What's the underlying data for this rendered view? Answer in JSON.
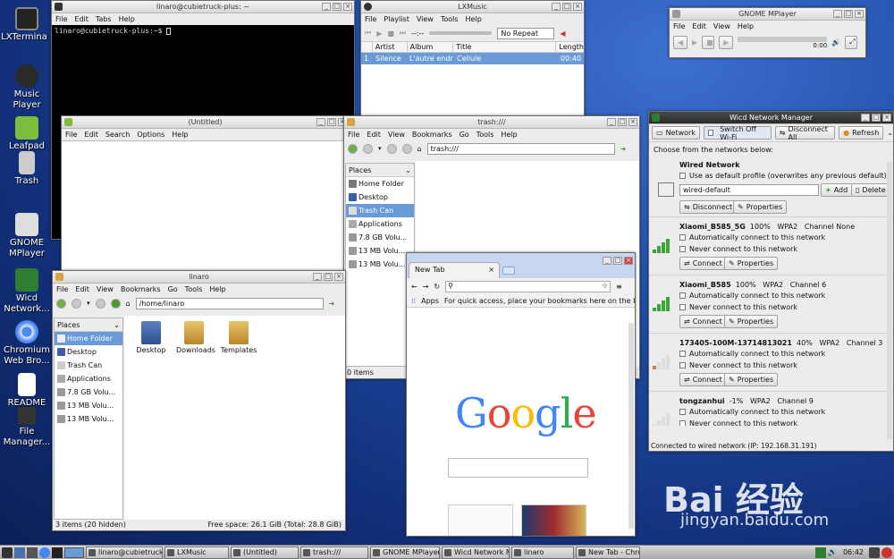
{
  "desktop": {
    "icons": [
      "LXTermina l",
      "Music Player",
      "Leafpad",
      "Trash",
      "GNOME MPlayer",
      "Wicd Network...",
      "Chromium Web Bro...",
      "README",
      "File Manager..."
    ]
  },
  "terminal": {
    "title": "linaro@cubietruck-plus: ~",
    "menu": [
      "File",
      "Edit",
      "Tabs",
      "Help"
    ],
    "prompt": "linaro@cubietruck-plus:~$ "
  },
  "lxmusic": {
    "title": "LXMusic",
    "menu": [
      "File",
      "Playlist",
      "View",
      "Tools",
      "Help"
    ],
    "time": "--:--",
    "repeat": "No Repeat",
    "columns": [
      "Artist",
      "Album",
      "Title",
      "Length"
    ],
    "row": {
      "num": "1",
      "artist": "Silence",
      "album": "L'autre endr...",
      "title": "Cellule",
      "length": "00:40"
    }
  },
  "mplayer": {
    "title": "GNOME MPlayer",
    "menu": [
      "File",
      "Edit",
      "View",
      "Help"
    ],
    "time": "0:00"
  },
  "leafpad": {
    "title": "(Untitled)",
    "menu": [
      "File",
      "Edit",
      "Search",
      "Options",
      "Help"
    ]
  },
  "trash": {
    "title": "trash:///",
    "menu": [
      "File",
      "Edit",
      "View",
      "Bookmarks",
      "Go",
      "Tools",
      "Help"
    ],
    "address": "trash:///",
    "places_header": "Places",
    "places": [
      "Home Folder",
      "Desktop",
      "Trash Can",
      "Applications",
      "7.8 GB Volu...",
      "13 MB Volu...",
      "13 MB Volu..."
    ],
    "status": "0 items"
  },
  "linaro": {
    "title": "linaro",
    "menu": [
      "File",
      "Edit",
      "View",
      "Bookmarks",
      "Go",
      "Tools",
      "Help"
    ],
    "address": "/home/linaro",
    "places_header": "Places",
    "places": [
      "Home Folder",
      "Desktop",
      "Trash Can",
      "Applications",
      "7.8 GB Volu...",
      "13 MB Volu...",
      "13 MB Volu..."
    ],
    "files": [
      "Desktop",
      "Downloads",
      "Templates"
    ],
    "status_left": "3 items (20 hidden)",
    "status_right": "Free space: 26.1 GiB (Total: 28.8 GiB)"
  },
  "chrome": {
    "tab": "New Tab",
    "apps": "Apps",
    "bookmarks_hint": "For quick access, place your bookmarks here on the book...",
    "logo": [
      "G",
      "o",
      "o",
      "g",
      "l",
      "e"
    ]
  },
  "wicd": {
    "title": "Wicd Network Manager",
    "toolbar": [
      "Network",
      "Switch Off Wi-Fi",
      "Disconnect All",
      "Refresh"
    ],
    "choose": "Choose from the networks below:",
    "wired": {
      "title": "Wired Network",
      "default_label": "Use as default profile (overwrites any previous default)",
      "profile": "wired-default",
      "add": "Add",
      "delete": "Delete",
      "disconnect": "Disconnect",
      "properties": "Properties"
    },
    "networks": [
      {
        "name": "Xiaomi_B585_5G",
        "strength": "100%",
        "security": "WPA2",
        "channel": "Channel None",
        "auto": "Automatically connect to this network",
        "never": "Never connect to this network",
        "connect": "Connect",
        "properties": "Properties",
        "level": 1.0
      },
      {
        "name": "Xiaomi_B585",
        "strength": "100%",
        "security": "WPA2",
        "channel": "Channel 6",
        "auto": "Automatically connect to this network",
        "never": "Never connect to this network",
        "connect": "Connect",
        "properties": "Properties",
        "level": 1.0
      },
      {
        "name": "173405-100M-13714813021",
        "strength": "40%",
        "security": "WPA2",
        "channel": "Channel 3",
        "auto": "Automatically connect to this network",
        "never": "Never connect to this network",
        "connect": "Connect",
        "properties": "Properties",
        "level": 0.4
      },
      {
        "name": "tongzanhui",
        "strength": "-1%",
        "security": "WPA2",
        "channel": "Channel 9",
        "auto": "Automatically connect to this network",
        "never": "Never connect to this network",
        "level": 0.0
      }
    ],
    "status": "Connected to wired network (IP: 192.168.31.191)"
  },
  "taskbar": {
    "items": [
      "linaro@cubietruck...",
      "LXMusic",
      "(Untitled)",
      "trash:///",
      "GNOME MPlayer",
      "Wicd Network M...",
      "linaro",
      "New Tab - Chro..."
    ],
    "clock": "06:42"
  },
  "watermark": {
    "text": "Bai 经验",
    "url": "jingyan.baidu.com"
  }
}
